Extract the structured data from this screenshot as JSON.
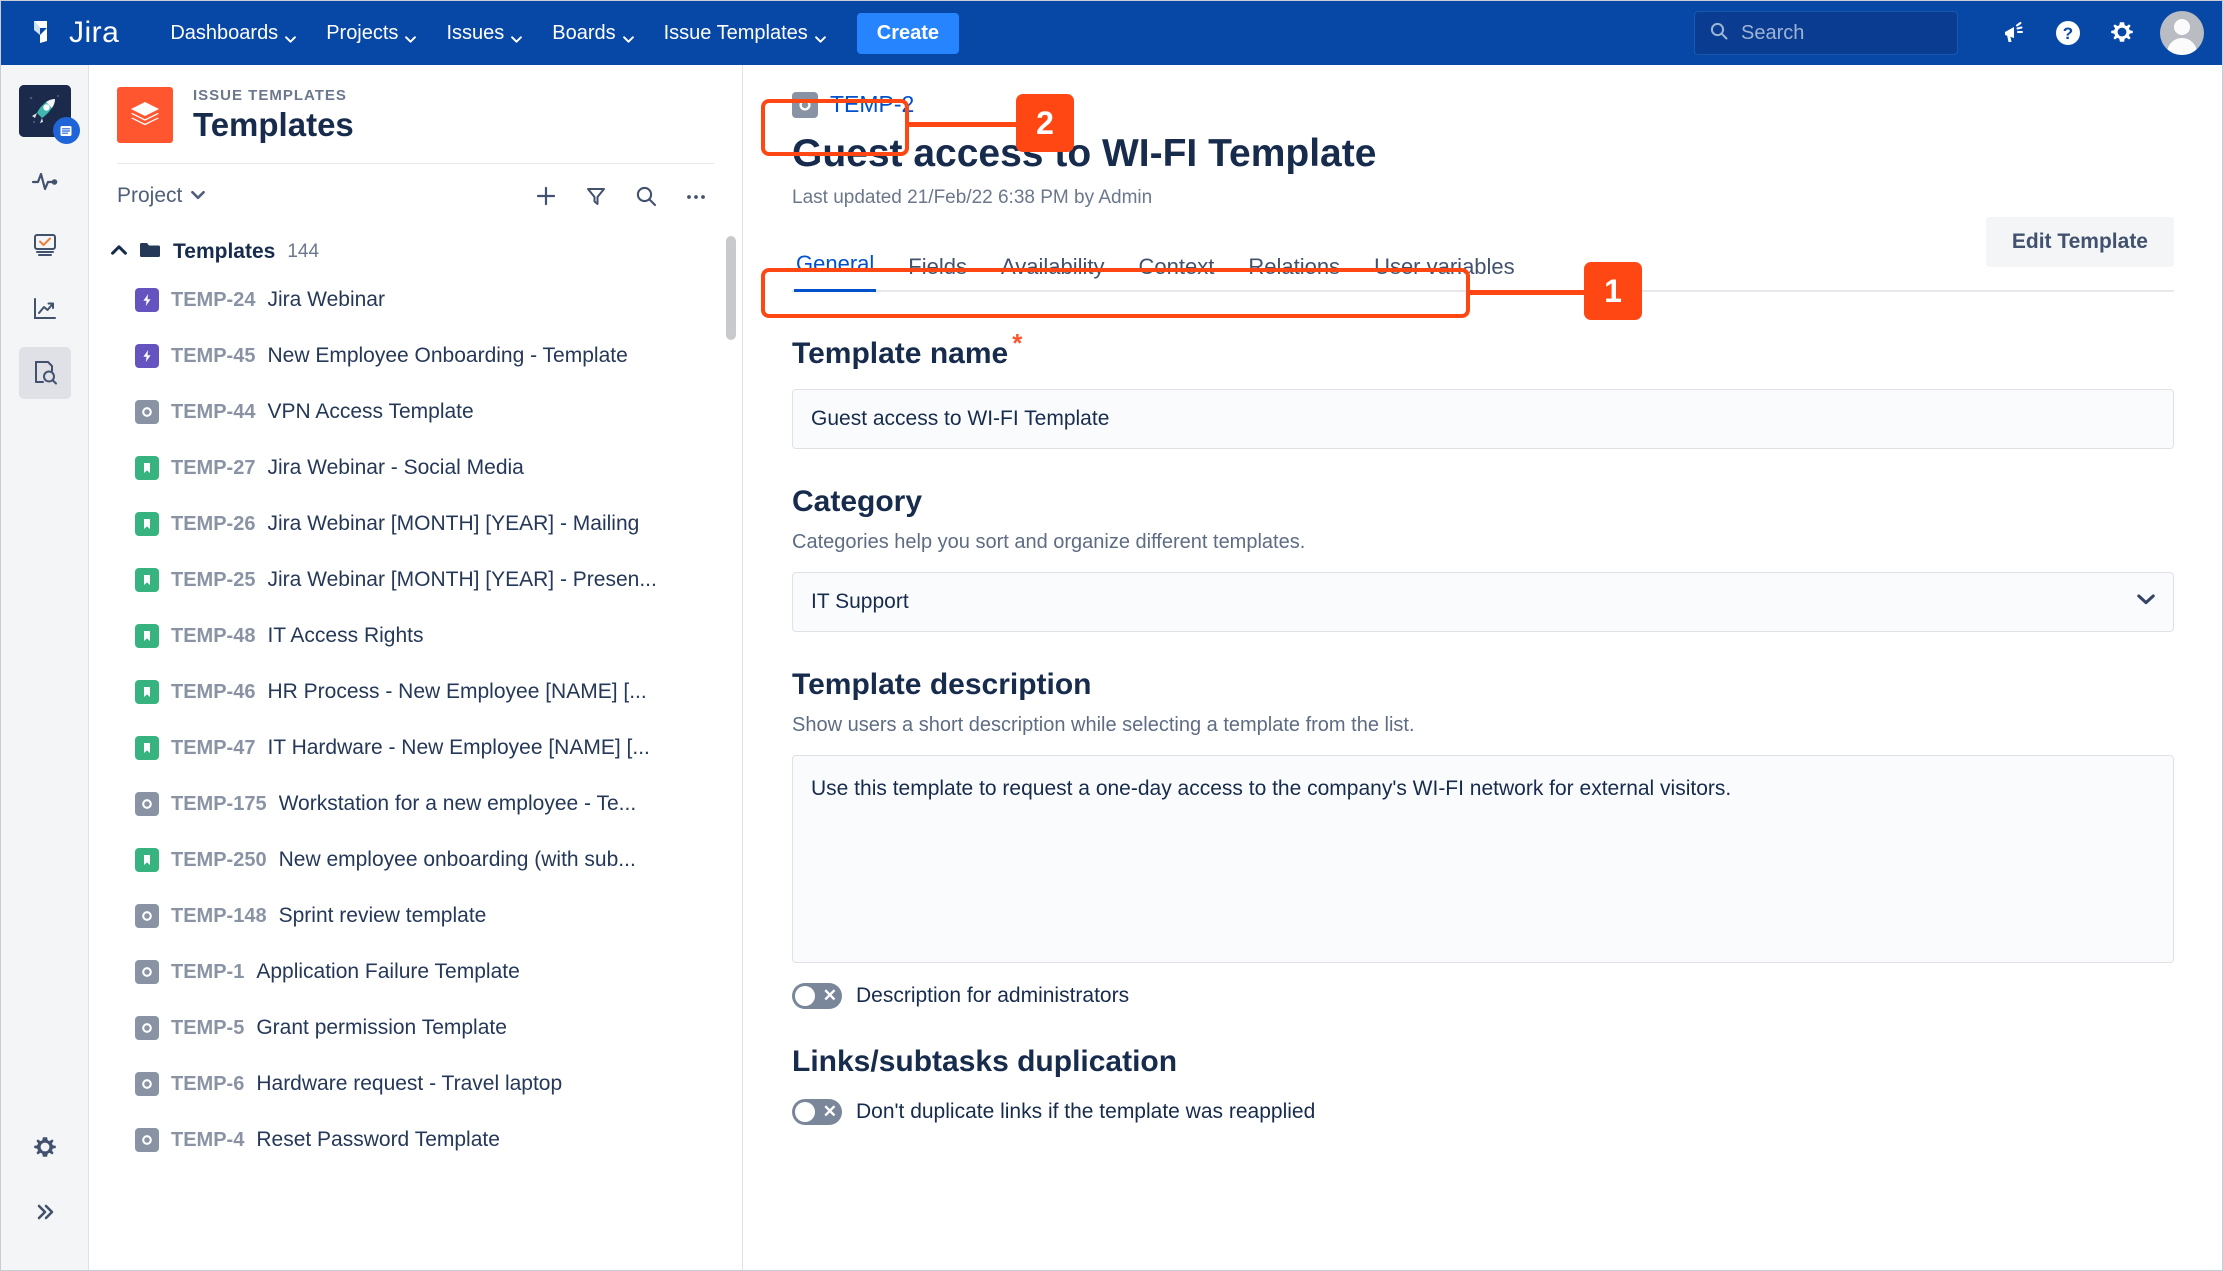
{
  "topnav": {
    "brand": "Jira",
    "items": [
      {
        "label": "Dashboards",
        "caret": "chevron-down-icon"
      },
      {
        "label": "Projects",
        "caret": "chevron-down-icon"
      },
      {
        "label": "Issues",
        "caret": "chevron-down-icon"
      },
      {
        "label": "Boards",
        "caret": "chevron-down-icon"
      },
      {
        "label": "Issue Templates",
        "caret": "chevron-down-icon"
      }
    ],
    "create_label": "Create",
    "search_placeholder": "Search",
    "icons": [
      "search-icon",
      "megaphone-icon",
      "help-icon",
      "settings-icon",
      "avatar"
    ]
  },
  "rail": {
    "items": [
      {
        "name": "project-avatar-rocket"
      },
      {
        "name": "activity-pulse-icon"
      },
      {
        "name": "board-icon"
      },
      {
        "name": "reports-icon"
      },
      {
        "name": "issue-templates-search-icon",
        "active": true
      }
    ],
    "bottom": [
      {
        "name": "settings-gear-icon"
      },
      {
        "name": "expand-sidebar-icon"
      }
    ]
  },
  "sidebar": {
    "eyebrow": "ISSUE TEMPLATES",
    "title": "Templates",
    "filter_label": "Project",
    "tools": [
      "add-icon",
      "filter-icon",
      "search-icon",
      "more-icon"
    ],
    "group": {
      "label": "Templates",
      "count": "144"
    },
    "templates": [
      {
        "key": "TEMP-24",
        "summary": "Jira Webinar",
        "type": "epic"
      },
      {
        "key": "TEMP-45",
        "summary": "New Employee Onboarding - Template",
        "type": "epic"
      },
      {
        "key": "TEMP-44",
        "summary": "VPN Access Template",
        "type": "task"
      },
      {
        "key": "TEMP-27",
        "summary": "Jira Webinar - Social Media",
        "type": "story"
      },
      {
        "key": "TEMP-26",
        "summary": "Jira Webinar [MONTH] [YEAR] - Mailing",
        "type": "story"
      },
      {
        "key": "TEMP-25",
        "summary": "Jira Webinar [MONTH] [YEAR] - Presen...",
        "type": "story"
      },
      {
        "key": "TEMP-48",
        "summary": "IT Access Rights",
        "type": "story"
      },
      {
        "key": "TEMP-46",
        "summary": "HR Process - New Employee [NAME] [...",
        "type": "story"
      },
      {
        "key": "TEMP-47",
        "summary": "IT Hardware - New Employee [NAME] [...",
        "type": "story"
      },
      {
        "key": "TEMP-175",
        "summary": "Workstation for a new employee - Te...",
        "type": "task"
      },
      {
        "key": "TEMP-250",
        "summary": "New employee onboarding (with sub...",
        "type": "story"
      },
      {
        "key": "TEMP-148",
        "summary": "Sprint review template",
        "type": "task"
      },
      {
        "key": "TEMP-1",
        "summary": "Application Failure Template",
        "type": "task"
      },
      {
        "key": "TEMP-5",
        "summary": "Grant permission Template",
        "type": "task"
      },
      {
        "key": "TEMP-6",
        "summary": "Hardware request - Travel laptop",
        "type": "task"
      },
      {
        "key": "TEMP-4",
        "summary": "Reset Password Template",
        "type": "task"
      }
    ]
  },
  "main": {
    "issue_key": "TEMP-2",
    "title": "Guest access to WI-FI Template",
    "last_updated": "Last updated 21/Feb/22 6:38 PM by Admin",
    "edit_button": "Edit Template",
    "tabs": [
      {
        "label": "General",
        "active": true
      },
      {
        "label": "Fields",
        "active": false
      },
      {
        "label": "Availability",
        "active": false
      },
      {
        "label": "Context",
        "active": false
      },
      {
        "label": "Relations",
        "active": false
      },
      {
        "label": "User variables",
        "active": false
      }
    ],
    "template_name": {
      "heading": "Template name",
      "required_mark": "*",
      "value": "Guest access to WI-FI Template"
    },
    "category": {
      "heading": "Category",
      "helper": "Categories help you sort and organize different templates.",
      "selected": "IT Support"
    },
    "description": {
      "heading": "Template description",
      "helper": "Show users a short description while selecting a template from the list.",
      "value": "Use this template to request a one-day access to the company's WI-FI network for external visitors.",
      "toggle_label": "Description for administrators",
      "toggle_state": "off"
    },
    "links": {
      "heading": "Links/subtasks duplication",
      "toggle_label": "Don't duplicate links if the template was reapplied",
      "toggle_state": "off"
    }
  },
  "annotations": {
    "callouts": [
      {
        "number": "1",
        "target": "tabs-row"
      },
      {
        "number": "2",
        "target": "issue-key-chip"
      }
    ],
    "accent_color": "#ff4713"
  }
}
